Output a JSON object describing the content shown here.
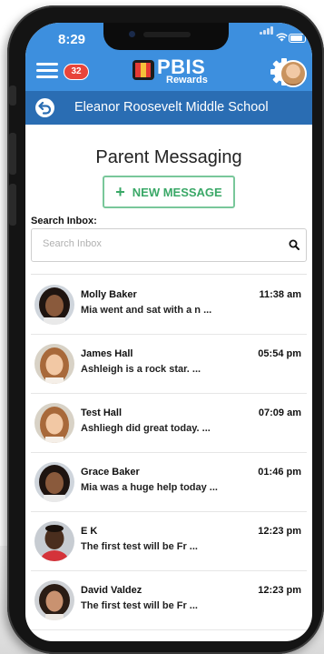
{
  "status_bar": {
    "time": "8:29"
  },
  "header": {
    "badge_count": "32",
    "logo_text": "PBIS",
    "logo_subtext": "Rewards",
    "brand_color": "#3d8fde"
  },
  "school_bar": {
    "school_name": "Eleanor Roosevelt Middle School",
    "color": "#2a6db3"
  },
  "page": {
    "title": "Parent Messaging",
    "new_message_label": "NEW MESSAGE",
    "new_message_icon": "plus-icon",
    "search_label": "Search Inbox:",
    "search_placeholder": "Search Inbox",
    "search_value": ""
  },
  "messages": [
    {
      "sender": "Molly Baker",
      "preview": "Mia went and sat with a n ...",
      "time": "11:38 am",
      "avatar": "avatar-dark-hair"
    },
    {
      "sender": "James Hall",
      "preview": "Ashleigh is a rock star. ...",
      "time": "05:54 pm",
      "avatar": "avatar-light-hair"
    },
    {
      "sender": "Test Hall",
      "preview": "Ashliegh did great today. ...",
      "time": "07:09 am",
      "avatar": "avatar-light-hair"
    },
    {
      "sender": "Grace Baker",
      "preview": "Mia was a huge help today ...",
      "time": "01:46 pm",
      "avatar": "avatar-dark-hair"
    },
    {
      "sender": "E K",
      "preview": "The first test will be Fr ...",
      "time": "12:23 pm",
      "avatar": "avatar-boy-red-shirt"
    },
    {
      "sender": "David Valdez",
      "preview": "The first test will be Fr ...",
      "time": "12:23 pm",
      "avatar": "avatar-curly-hair"
    }
  ]
}
